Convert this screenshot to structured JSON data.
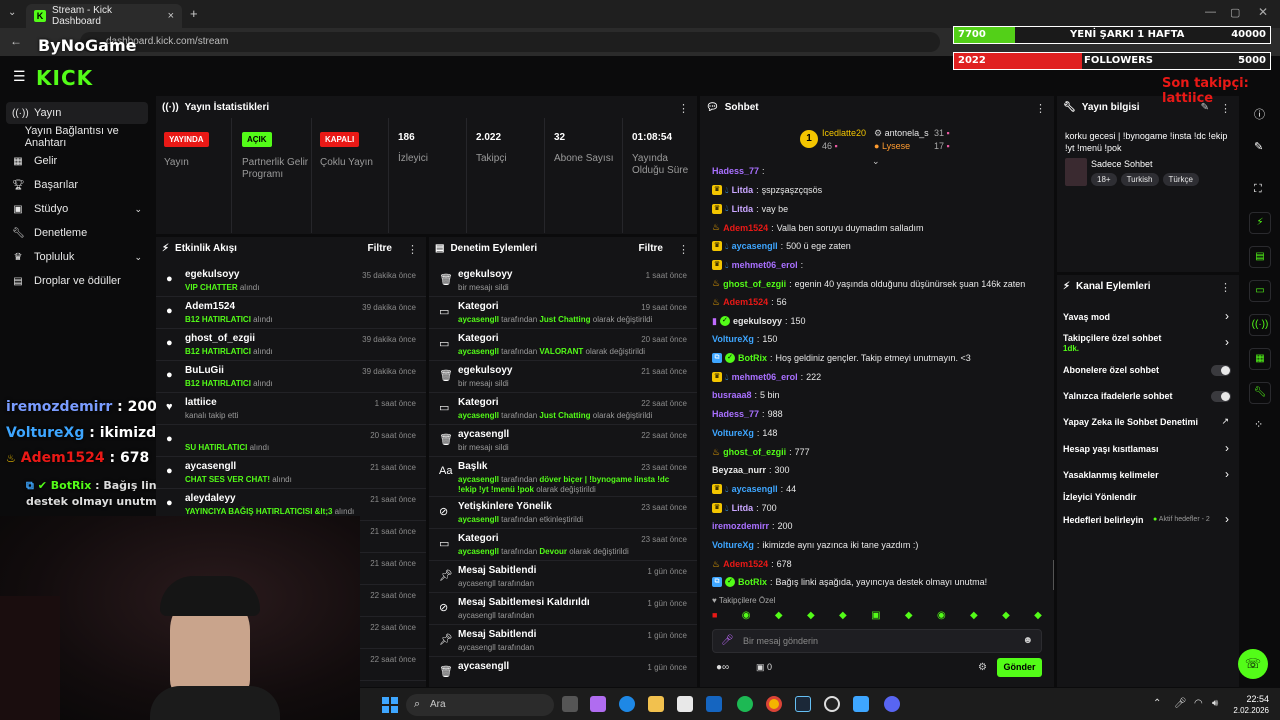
{
  "browser": {
    "tab_title": "Stream - Kick Dashboard",
    "url": "dashboard.kick.com/stream",
    "new_tab": "+",
    "close_tab": "×"
  },
  "brand": {
    "logo": "KICK",
    "watermark": "ByNoGame"
  },
  "sidebar": {
    "items": [
      {
        "label": "Yayın",
        "icon": "broadcast-icon"
      },
      {
        "label": "Yayın Bağlantısı ve Anahtarı",
        "icon": ""
      },
      {
        "label": "Gelir",
        "icon": "wallet-icon"
      },
      {
        "label": "Başarılar",
        "icon": "trophy-icon"
      },
      {
        "label": "Stüdyo",
        "icon": "studio-icon"
      },
      {
        "label": "Denetleme",
        "icon": "wrench-icon"
      },
      {
        "label": "Topluluk",
        "icon": "community-icon"
      },
      {
        "label": "Droplar ve ödüller",
        "icon": "gift-icon"
      }
    ]
  },
  "stats": {
    "title": "Yayın İstatistikleri",
    "items": [
      {
        "badge": "YAYINDA",
        "label": "Yayın"
      },
      {
        "badge": "AÇIK",
        "label": "Partnerlik Gelir Programı"
      },
      {
        "badge": "KAPALI",
        "label": "Çoklu Yayın"
      },
      {
        "value": "186",
        "label": "İzleyici"
      },
      {
        "value": "2.022",
        "label": "Takipçi"
      },
      {
        "value": "32",
        "label": "Abone Sayısı"
      },
      {
        "value": "01:08:54",
        "label": "Yayında Olduğu Süre"
      }
    ]
  },
  "activity": {
    "title": "Etkinlik Akışı",
    "filter": "Filtre",
    "rows": [
      {
        "user": "egekulsoyy",
        "detail": "VIP CHATTER",
        "suffix": "alındı",
        "time": "35 dakika önce"
      },
      {
        "user": "Adem1524",
        "detail": "B12 HATIRLATICI",
        "suffix": "alındı",
        "time": "39 dakika önce"
      },
      {
        "user": "ghost_of_ezgii",
        "detail": "B12 HATIRLATICI",
        "suffix": "alındı",
        "time": "39 dakika önce"
      },
      {
        "user": "BuLuGii",
        "detail": "B12 HATIRLATICI",
        "suffix": "alındı",
        "time": "39 dakika önce"
      },
      {
        "user": "lattiice",
        "detail": "",
        "suffix": "kanalı takip etti",
        "time": "1 saat önce"
      },
      {
        "user": "",
        "detail": "SU HATIRLATICI",
        "suffix": "alındı",
        "time": "20 saat önce"
      },
      {
        "user": "aycasengll",
        "detail": "CHAT SES VER CHAT!",
        "suffix": "alındı",
        "time": "21 saat önce"
      },
      {
        "user": "aleydaleyy",
        "detail": "YAYINCIYA BAĞIŞ HATIRLATICISI &lt;3",
        "suffix": "alındı",
        "time": "21 saat önce"
      },
      {
        "user": "",
        "detail": "",
        "suffix": "",
        "time": "21 saat önce"
      },
      {
        "user": "",
        "detail": "",
        "suffix": "",
        "time": "21 saat önce"
      },
      {
        "user": "",
        "detail": "",
        "suffix": "",
        "time": "22 saat önce"
      },
      {
        "user": "",
        "detail": "",
        "suffix": "",
        "time": "22 saat önce"
      },
      {
        "user": "",
        "detail": "",
        "suffix": "",
        "time": "22 saat önce"
      }
    ]
  },
  "moderation": {
    "title": "Denetim Eylemleri",
    "filter": "Filtre",
    "rows": [
      {
        "title": "egekulsoyy",
        "pre": "",
        "g": "",
        "post": "bir mesajı sildi",
        "time": "1 saat önce",
        "icon": "trash-icon"
      },
      {
        "title": "Kategori",
        "pre": "",
        "g": "aycasengll",
        "post": " tarafından ",
        "g2": "Just Chatting",
        "post2": " olarak değiştirildi",
        "time": "19 saat önce",
        "icon": "category-icon"
      },
      {
        "title": "Kategori",
        "pre": "",
        "g": "aycasengll",
        "post": " tarafından ",
        "g2": "VALORANT",
        "post2": " olarak değiştirildi",
        "time": "20 saat önce",
        "icon": "category-icon"
      },
      {
        "title": "egekulsoyy",
        "pre": "",
        "g": "",
        "post": "bir mesajı sildi",
        "time": "21 saat önce",
        "icon": "trash-icon"
      },
      {
        "title": "Kategori",
        "pre": "",
        "g": "aycasengll",
        "post": " tarafından ",
        "g2": "Just Chatting",
        "post2": " olarak değiştirildi",
        "time": "22 saat önce",
        "icon": "category-icon"
      },
      {
        "title": "aycasengll",
        "pre": "",
        "g": "",
        "post": "bir mesajı sildi",
        "time": "22 saat önce",
        "icon": "trash-icon"
      },
      {
        "title": "Başlık",
        "pre": "",
        "g": "aycasengll",
        "post": " tarafından ",
        "g2": "döver biçer | !bynogame linsta !dc !ekip !yt !menü !pok",
        "post2": " olarak değiştirildi",
        "time": "23 saat önce",
        "icon": "title-icon"
      },
      {
        "title": "Yetişkinlere Yönelik",
        "pre": "",
        "g": "aycasengll",
        "post": " tarafından etkinleştirildi",
        "time": "23 saat önce",
        "icon": "eye-off-icon"
      },
      {
        "title": "Kategori",
        "pre": "",
        "g": "aycasengll",
        "post": " tarafından ",
        "g2": "Devour",
        "post2": " olarak değiştirildi",
        "time": "23 saat önce",
        "icon": "category-icon"
      },
      {
        "title": "Mesaj Sabitlendi",
        "pre": "",
        "g": "",
        "post": "aycasengll tarafından",
        "time": "1 gün önce",
        "icon": "pin-icon"
      },
      {
        "title": "Mesaj Sabitlemesi Kaldırıldı",
        "pre": "",
        "g": "",
        "post": "aycasengll tarafından",
        "time": "1 gün önce",
        "icon": "unpin-icon"
      },
      {
        "title": "Mesaj Sabitlendi",
        "pre": "",
        "g": "",
        "post": "aycasengll tarafından",
        "time": "1 gün önce",
        "icon": "pin-icon"
      },
      {
        "title": "aycasengll",
        "pre": "",
        "g": "",
        "post": "",
        "time": "1 gün önce",
        "icon": "trash-icon"
      }
    ]
  },
  "chat": {
    "title": "Sohbet",
    "leaders": [
      {
        "name": "Icedlatte20",
        "count": "46",
        "rank": "1"
      },
      {
        "name": "antonela_s",
        "count": "31"
      },
      {
        "name": "Lysese",
        "count": "17"
      }
    ],
    "messages": [
      {
        "user": "Hadess_77",
        "color": "#a970ff",
        "text": ""
      },
      {
        "user": "Litda",
        "color": "#c9a6ff",
        "text": "şspzşaşzçqsös"
      },
      {
        "user": "Litda",
        "color": "#c9a6ff",
        "text": "vay be"
      },
      {
        "user": "Adem1524",
        "color": "#e91916",
        "text": "Valla ben soruyu duymadım salladım"
      },
      {
        "user": "aycasengll",
        "color": "#3ea6ff",
        "text": "500 ü ege zaten"
      },
      {
        "user": "mehmet06_erol",
        "color": "#a970ff",
        "text": ""
      },
      {
        "user": "ghost_of_ezgii",
        "color": "#53fc18",
        "text": "egenin 40 yaşında olduğunu düşünürsek şuan 146k zaten"
      },
      {
        "user": "Adem1524",
        "color": "#e91916",
        "text": "56"
      },
      {
        "user": "egekulsoyy",
        "color": "#e8e8e8",
        "text": "150"
      },
      {
        "user": "VoltureXg",
        "color": "#3ea6ff",
        "text": "150"
      },
      {
        "user": "BotRix",
        "color": "#53fc18",
        "text": "Hoş geldiniz gençler. Takip etmeyi unutmayın. <3"
      },
      {
        "user": "mehmet06_erol",
        "color": "#a970ff",
        "text": "222"
      },
      {
        "user": "busraaa8",
        "color": "#a970ff",
        "text": "5 bin"
      },
      {
        "user": "Hadess_77",
        "color": "#a970ff",
        "text": "988"
      },
      {
        "user": "VoltureXg",
        "color": "#3ea6ff",
        "text": "148"
      },
      {
        "user": "ghost_of_ezgii",
        "color": "#53fc18",
        "text": "777"
      },
      {
        "user": "Beyzaa_nurr",
        "color": "#e8e8e8",
        "text": "300"
      },
      {
        "user": "aycasengll",
        "color": "#3ea6ff",
        "text": "44"
      },
      {
        "user": "Litda",
        "color": "#c9a6ff",
        "text": "700"
      },
      {
        "user": "iremozdemirr",
        "color": "#a970ff",
        "text": "200"
      },
      {
        "user": "VoltureXg",
        "color": "#3ea6ff",
        "text": "ikimizde aynı yazınca iki tane yazdım :)"
      },
      {
        "user": "Adem1524",
        "color": "#e91916",
        "text": "678"
      },
      {
        "user": "BotRix",
        "color": "#53fc18",
        "text": "Bağış linki aşağıda, yayıncıya destek olmayı unutma!"
      }
    ],
    "followers_only": "Takipçilere Özel",
    "placeholder": "Bir mesaj gönderin",
    "send": "Gönder",
    "viewer_count": "0"
  },
  "stream_info": {
    "title": "Yayın bilgisi",
    "stream_title": "korku gecesi | !bynogame !insta !dc !ekip !yt !menü !pok",
    "category": "Sadece Sohbet",
    "tags": [
      "18+",
      "Turkish",
      "Türkçe"
    ]
  },
  "channel_actions": {
    "title": "Kanal Eylemleri",
    "items": [
      {
        "label": "Yavaş mod",
        "type": "arrow"
      },
      {
        "label": "Takipçilere özel sohbet",
        "sub": "1dk.",
        "type": "arrow"
      },
      {
        "label": "Abonelere özel sohbet",
        "type": "toggle"
      },
      {
        "label": "Yalnızca ifadelerle sohbet",
        "type": "toggle"
      },
      {
        "label": "Yapay Zeka ile Sohbet Denetimi",
        "type": "external"
      },
      {
        "label": "Hesap yaşı kısıtlaması",
        "type": "arrow"
      },
      {
        "label": "Yasaklanmış kelimeler",
        "type": "arrow"
      },
      {
        "label": "İzleyici Yönlendir",
        "type": "none"
      },
      {
        "label": "Hedefleri belirleyin",
        "sub": "Aktif hedefler - 2",
        "type": "arrow"
      }
    ]
  },
  "overlay": {
    "goal1_left": "7700",
    "goal1_label": "YENİ ŞARKI 1 HAFTA",
    "goal1_right": "40000",
    "goal1_progress": 0.1925,
    "goal2_left": "2022",
    "goal2_label": "FOLLOWERS",
    "goal2_right": "5000",
    "goal2_progress": 0.4044,
    "last_follower": "Son takipçi: lattiice",
    "chat": [
      {
        "user": "iremozdemirr",
        "text": " : 200",
        "color": "#a970ff"
      },
      {
        "user": "VoltureXg",
        "text": " : ikimizde aynı yazınca iki tane yazdım :)",
        "color": "#3ea6ff"
      },
      {
        "user": "Adem1524",
        "text": " : 678",
        "color": "#e91916"
      },
      {
        "user": "BotRix",
        "text": " : Bağış linki aşağıda, yayıncıya destek olmayı unutma!",
        "color": "#53fc18"
      }
    ]
  },
  "taskbar": {
    "search_placeholder": "Ara",
    "time": "22:54",
    "date": "2.02.2026"
  }
}
